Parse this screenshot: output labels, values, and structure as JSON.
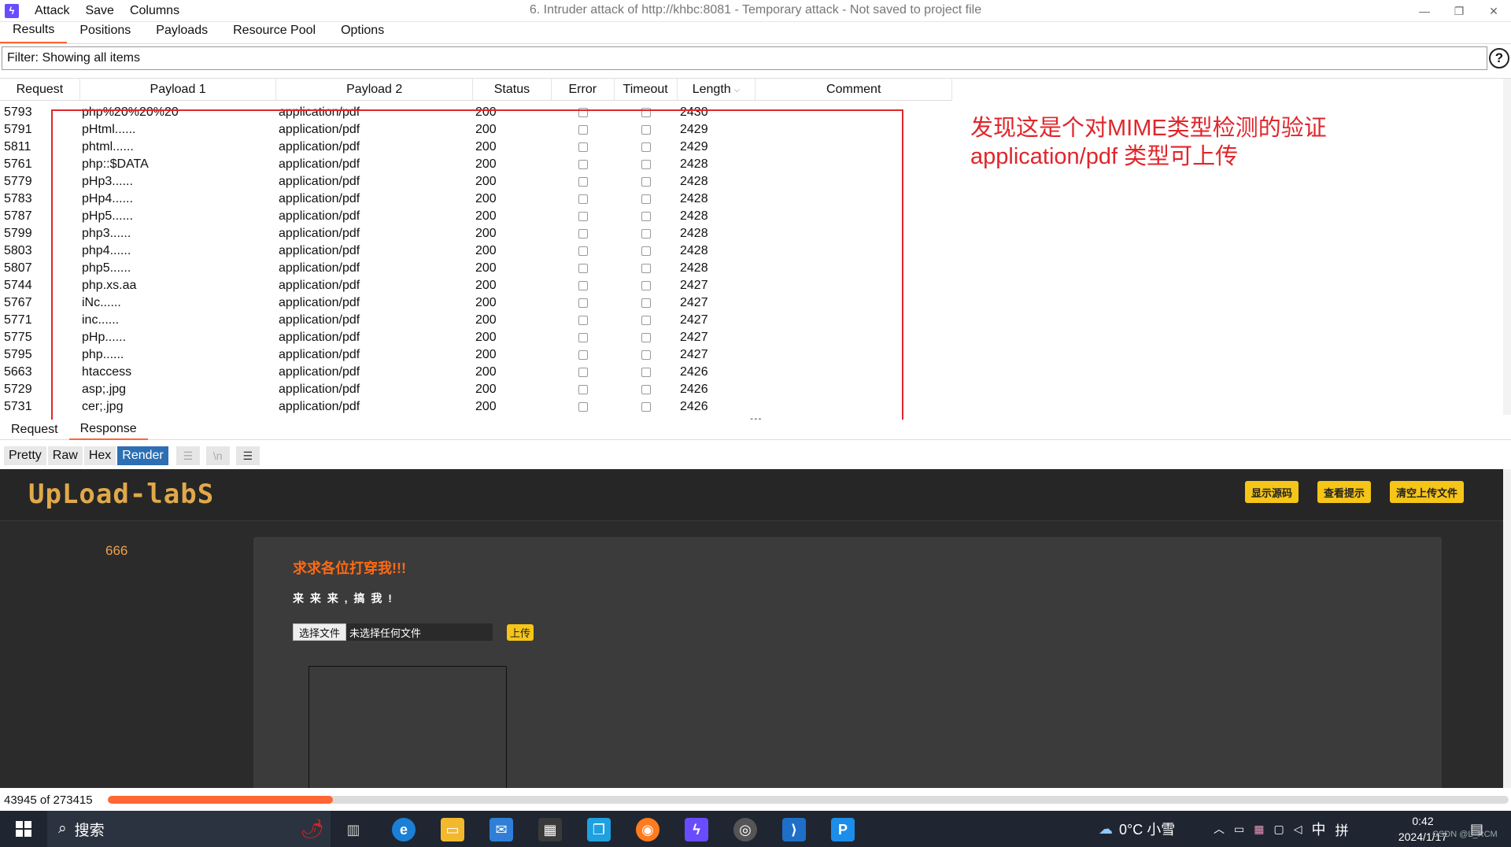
{
  "titlebar": {
    "menus": [
      "Attack",
      "Save",
      "Columns"
    ],
    "window_title": "6. Intruder attack of http://khbc:8081 - Temporary attack - Not saved to project file",
    "controls": [
      "—",
      "❐",
      "✕"
    ]
  },
  "tabs": [
    "Results",
    "Positions",
    "Payloads",
    "Resource Pool",
    "Options"
  ],
  "filter": {
    "text": "Filter: Showing all items",
    "help": "?"
  },
  "table": {
    "columns": [
      "Request",
      "Payload 1",
      "Payload 2",
      "Status",
      "Error",
      "Timeout",
      "Length",
      "Comment"
    ],
    "sort_column": "Length",
    "rows": [
      {
        "request": "5793",
        "p1": "php%20%20%20",
        "p2": "application/pdf",
        "status": "200",
        "length": "2430"
      },
      {
        "request": "5791",
        "p1": "pHtml......",
        "p2": "application/pdf",
        "status": "200",
        "length": "2429"
      },
      {
        "request": "5811",
        "p1": "phtml......",
        "p2": "application/pdf",
        "status": "200",
        "length": "2429"
      },
      {
        "request": "5761",
        "p1": "php::$DATA",
        "p2": "application/pdf",
        "status": "200",
        "length": "2428"
      },
      {
        "request": "5779",
        "p1": "pHp3......",
        "p2": "application/pdf",
        "status": "200",
        "length": "2428"
      },
      {
        "request": "5783",
        "p1": "pHp4......",
        "p2": "application/pdf",
        "status": "200",
        "length": "2428"
      },
      {
        "request": "5787",
        "p1": "pHp5......",
        "p2": "application/pdf",
        "status": "200",
        "length": "2428"
      },
      {
        "request": "5799",
        "p1": "php3......",
        "p2": "application/pdf",
        "status": "200",
        "length": "2428"
      },
      {
        "request": "5803",
        "p1": "php4......",
        "p2": "application/pdf",
        "status": "200",
        "length": "2428"
      },
      {
        "request": "5807",
        "p1": "php5......",
        "p2": "application/pdf",
        "status": "200",
        "length": "2428"
      },
      {
        "request": "5744",
        "p1": "php.xs.aa",
        "p2": "application/pdf",
        "status": "200",
        "length": "2427"
      },
      {
        "request": "5767",
        "p1": "iNc......",
        "p2": "application/pdf",
        "status": "200",
        "length": "2427"
      },
      {
        "request": "5771",
        "p1": "inc......",
        "p2": "application/pdf",
        "status": "200",
        "length": "2427"
      },
      {
        "request": "5775",
        "p1": "pHp......",
        "p2": "application/pdf",
        "status": "200",
        "length": "2427"
      },
      {
        "request": "5795",
        "p1": "php......",
        "p2": "application/pdf",
        "status": "200",
        "length": "2427"
      },
      {
        "request": "5663",
        "p1": "htaccess",
        "p2": "application/pdf",
        "status": "200",
        "length": "2426"
      },
      {
        "request": "5729",
        "p1": "asp;.jpg",
        "p2": "application/pdf",
        "status": "200",
        "length": "2426"
      },
      {
        "request": "5731",
        "p1": "cer;.jpg",
        "p2": "application/pdf",
        "status": "200",
        "length": "2426"
      }
    ]
  },
  "annotation": {
    "line1": "发现这是个对MIME类型检测的验证",
    "line2": "application/pdf 类型可上传",
    "color": "#e0262b"
  },
  "message_tabs": [
    "Request",
    "Response"
  ],
  "view_buttons": [
    "Pretty",
    "Raw",
    "Hex",
    "Render"
  ],
  "view_icons": [
    "☰",
    "\\n",
    "☰"
  ],
  "render": {
    "logo": "UpLoad-labS",
    "header_buttons": [
      "显示源码",
      "查看提示",
      "清空上传文件"
    ],
    "side_number": "666",
    "panel_title": "求求各位打穿我!!!",
    "panel_text": "来 来 来 , 搞 我 !",
    "file_button": "选择文件",
    "file_status": "未选择任何文件",
    "upload_button": "上传"
  },
  "progress": {
    "text": "43945 of 273415",
    "done": 43945,
    "total": 273415,
    "color": "#ff6633"
  },
  "taskbar": {
    "search_placeholder": "搜索",
    "weather": "0°C 小雪",
    "ime_lang": "中",
    "ime_mode": "拼",
    "time": "0:42",
    "date": "2024/1/17",
    "watermark": "CSDN @L_RCM"
  }
}
